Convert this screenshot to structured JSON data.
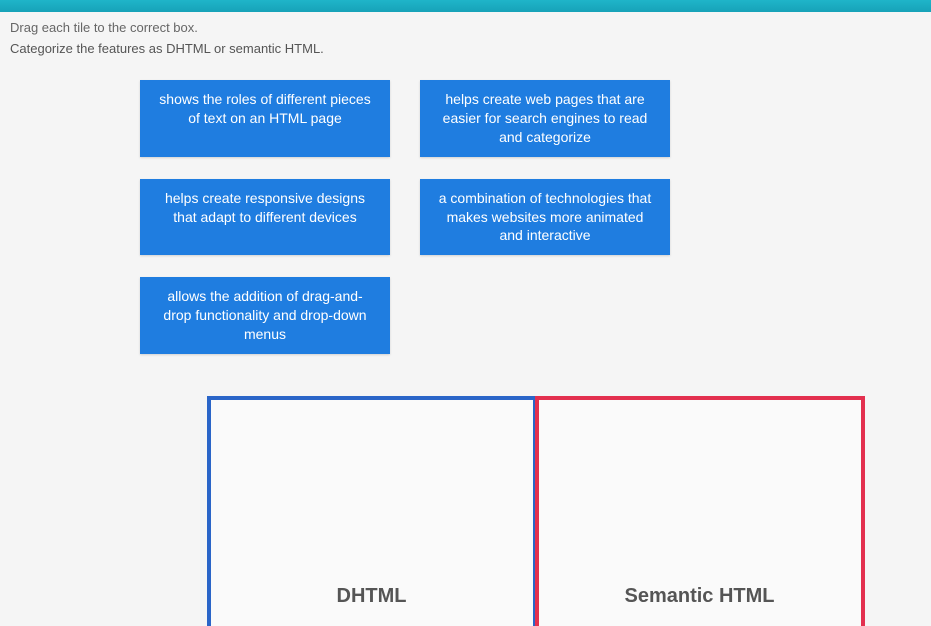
{
  "instructions": {
    "line1": "Drag each tile to the correct box.",
    "line2": "Categorize the features as DHTML or semantic HTML."
  },
  "tiles": {
    "t1": "shows the roles of different pieces of text on an HTML page",
    "t2": "helps create web pages that are easier for search engines to read and categorize",
    "t3": "helps create responsive designs that adapt to different devices",
    "t4": "a combination of technologies that makes websites more animated and interactive",
    "t5": "allows the addition of drag-and-drop functionality and drop-down menus"
  },
  "dropzones": {
    "dhtml_label": "DHTML",
    "semantic_label": "Semantic HTML"
  },
  "colors": {
    "tile_bg": "#1f7de0",
    "dhtml_border": "#2a65c8",
    "semantic_border": "#e3304f",
    "header": "#17a2b8"
  }
}
